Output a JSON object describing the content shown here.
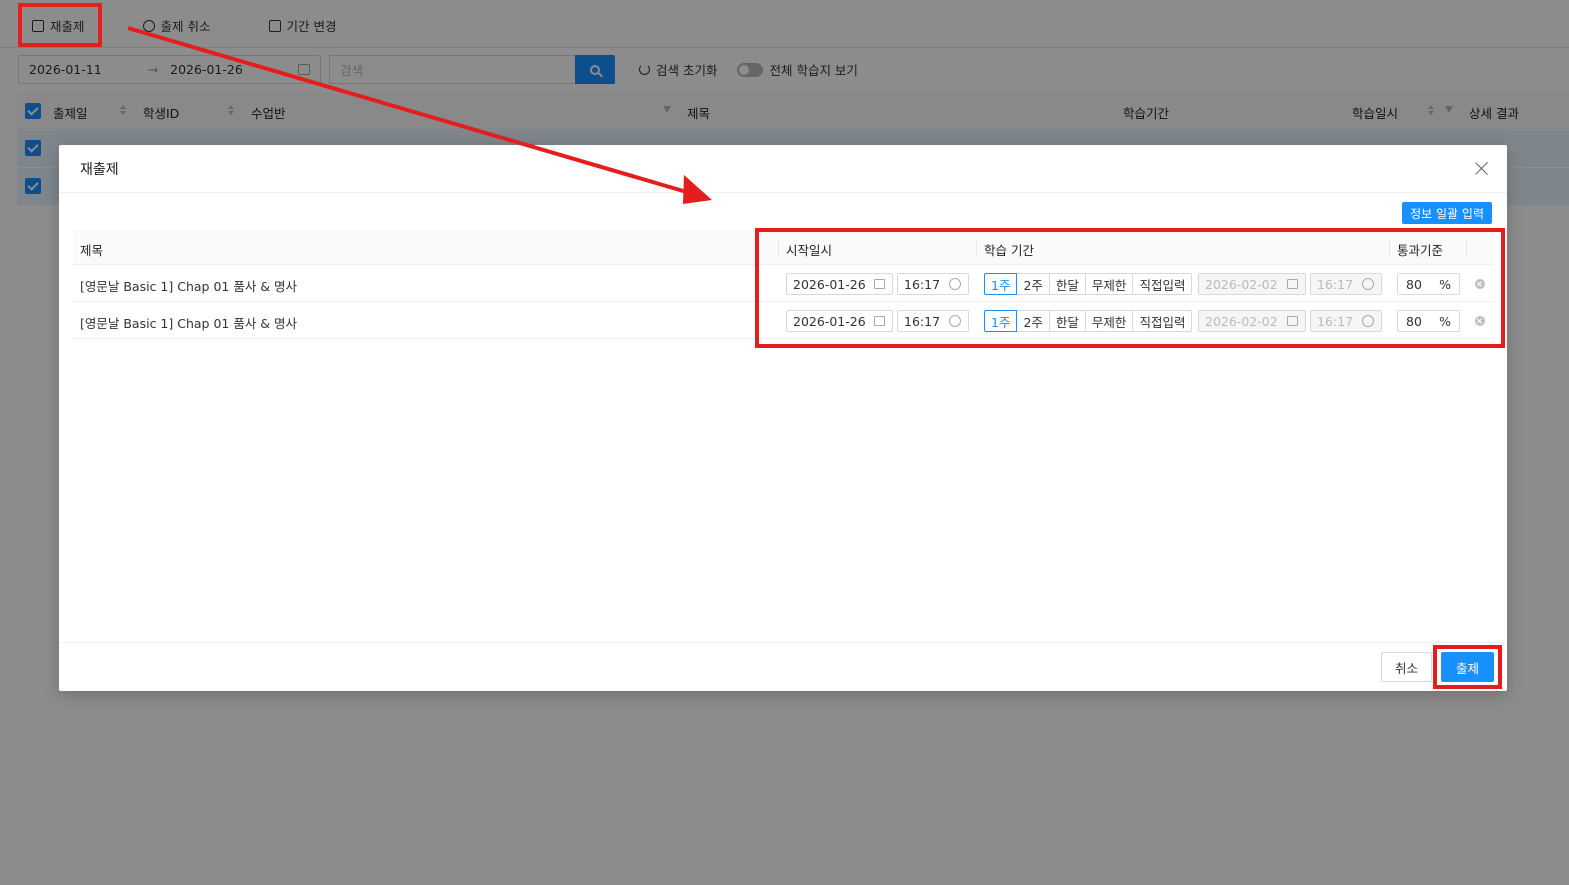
{
  "toolbar": {
    "resubmit_label": "재출제",
    "cancel_submit_label": "출제 취소",
    "change_period_label": "기간 변경"
  },
  "filters": {
    "date_from": "2026-01-11",
    "date_arrow": "→",
    "date_to": "2026-01-26",
    "search_placeholder": "검색",
    "reset_label": "검색 초기화",
    "show_all_label": "전체 학습지 보기"
  },
  "table": {
    "headers": {
      "submit_date": "출제일",
      "student_id": "학생ID",
      "class": "수업반",
      "title": "제목",
      "study_period": "학습기간",
      "study_datetime": "학습일시",
      "detail_result": "상세 결과"
    }
  },
  "modal": {
    "title": "재출제",
    "bulk_input_label": "정보 일괄 입력",
    "headers": {
      "title": "제목",
      "start_datetime": "시작일시",
      "study_period": "학습 기간",
      "pass_criteria": "통과기준"
    },
    "period_options": [
      "1주",
      "2주",
      "한달",
      "무제한",
      "직접입력"
    ],
    "rows": [
      {
        "title": "[영문날 Basic 1] Chap 01 품사 & 명사",
        "start_date": "2026-01-26",
        "start_time": "16:17",
        "end_date": "2026-02-02",
        "end_time": "16:17",
        "pass_value": "80",
        "pass_unit": "%"
      },
      {
        "title": "[영문날 Basic 1] Chap 01 품사 & 명사",
        "start_date": "2026-01-26",
        "start_time": "16:17",
        "end_date": "2026-02-02",
        "end_time": "16:17",
        "pass_value": "80",
        "pass_unit": "%"
      }
    ],
    "active_period": "1주",
    "cancel_label": "취소",
    "submit_label": "출제"
  },
  "colors": {
    "primary": "#1890ff",
    "annotation": "#e41e1e",
    "overlay": "rgba(0,0,0,0.45)"
  }
}
